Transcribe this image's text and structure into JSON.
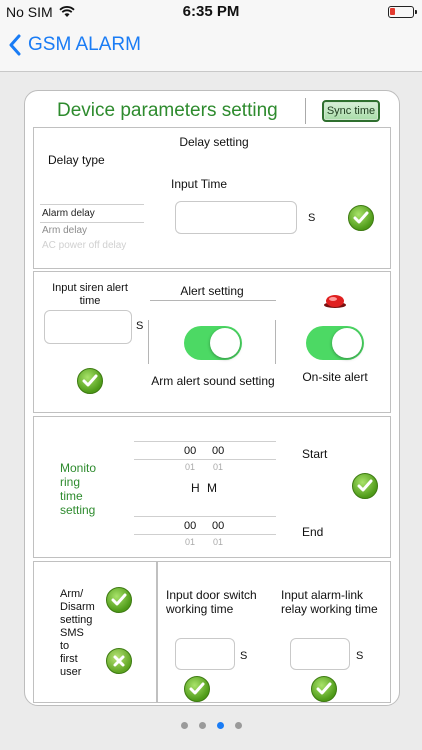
{
  "status": {
    "carrier": "No SIM",
    "time": "6:35 PM"
  },
  "nav": {
    "title": "GSM ALARM"
  },
  "card": {
    "title": "Device parameters setting",
    "sync_label": "Sync time"
  },
  "delay": {
    "heading": "Delay setting",
    "type_label": "Delay type",
    "input_time_label": "Input Time",
    "unit": "S",
    "types": [
      "Alarm delay",
      "Arm delay",
      "AC power off delay"
    ]
  },
  "alert": {
    "siren_label_1": "Input siren alert",
    "siren_label_2": "time",
    "unit": "S",
    "heading": "Alert setting",
    "arm_sound_label": "Arm alert sound setting",
    "onsite_label": "On-site alert"
  },
  "monitoring": {
    "label_lines": [
      "Monito",
      "ring",
      "time",
      "setting"
    ],
    "start_label": "Start",
    "end_label": "End",
    "start_hour": "00",
    "start_min": "00",
    "start_hour_next": "01",
    "start_min_next": "01",
    "end_hour": "00",
    "end_min": "00",
    "end_hour_next": "01",
    "end_min_next": "01",
    "h_label": "H",
    "m_label": "M"
  },
  "sms": {
    "label_lines": [
      "Arm/",
      "Disarm",
      "setting",
      "SMS",
      "to",
      "first",
      "user"
    ]
  },
  "door": {
    "label_1": "Input door switch",
    "label_2": "working time",
    "unit": "S"
  },
  "relay": {
    "label_1": "Input alarm-link",
    "label_2": "relay working time",
    "unit": "S"
  },
  "pager": {
    "count": 4,
    "active_index": 2
  }
}
